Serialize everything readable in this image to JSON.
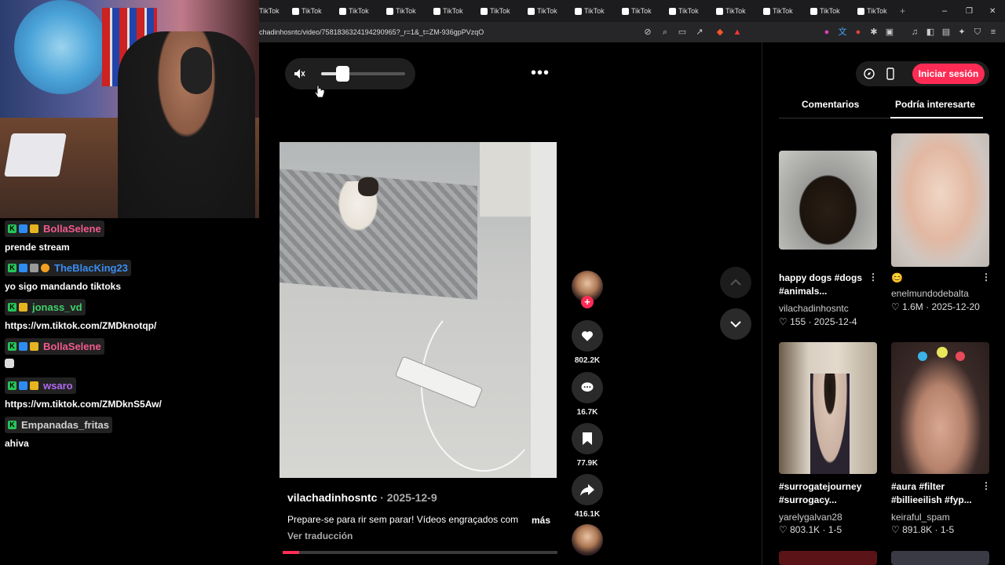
{
  "chat": {
    "messages": [
      {
        "user": "BollaSelene",
        "user_color": "#f25a8c",
        "text": "prende stream"
      },
      {
        "user": "TheBlacKing23",
        "user_color": "#3a8cf0",
        "text": "yo sigo mandando tiktoks"
      },
      {
        "user": "jonass_vd",
        "user_color": "#3ed06a",
        "text": "https://vm.tiktok.com/ZMDknotqp/"
      },
      {
        "user": "BollaSelene",
        "user_color": "#f25a8c",
        "text": ""
      },
      {
        "user": "wsaro",
        "user_color": "#b06af0",
        "text": "https://vm.tiktok.com/ZMDknS5Aw/"
      },
      {
        "user": "Empanadas_fritas",
        "user_color": "#d0d0d0",
        "text": "ahiva"
      }
    ]
  },
  "browser": {
    "tabs": [
      "TikTok",
      "TikTok",
      "TikTok",
      "TikTok",
      "TikTok",
      "TikTok",
      "TikTok",
      "TikTok",
      "TikTok",
      "TikTok",
      "TikTok",
      "TikTok",
      "TikTok",
      "TikTok"
    ],
    "url": "chadinhosntc/video/7581836324194290965?_r=1&_t=ZM-936gpPVzqO",
    "new_tab": "+",
    "win_minimize": "–",
    "win_maximize": "❐",
    "win_close": "✕"
  },
  "video": {
    "author": "vilachadinhosntc",
    "date": " · 2025-12-9",
    "caption": "Prepare-se para rir sem parar! Vídeos engraçados com",
    "more": "más",
    "translate": "Ver traducción",
    "progress": 0.06,
    "volume": 0.25
  },
  "actions": {
    "likes": "802.2K",
    "comments": "16.7K",
    "saves": "77.9K",
    "shares": "416.1K",
    "follow": "+"
  },
  "panel": {
    "login": "Iniciar sesión",
    "tab_comments": "Comentarios",
    "tab_interest": "Podría interesarte",
    "cards": [
      {
        "title": "happy dogs #dogs #animals...",
        "user": "vilachadinhosntc",
        "likes": "155",
        "date": "2025-12-4"
      },
      {
        "title": "😊",
        "user": "enelmundodebalta",
        "likes": "1.6M",
        "date": "2025-12-20"
      },
      {
        "title": "#surrogatejourney #surrogacy...",
        "user": "yarelygalvan28",
        "likes": "803.1K",
        "date": "1-5"
      },
      {
        "title": "#aura #filter #billieeilish #fyp...",
        "user": "keiraful_spam",
        "likes": "891.8K",
        "date": "1-5"
      }
    ]
  },
  "colors": {
    "accent": "#fe2c55"
  }
}
